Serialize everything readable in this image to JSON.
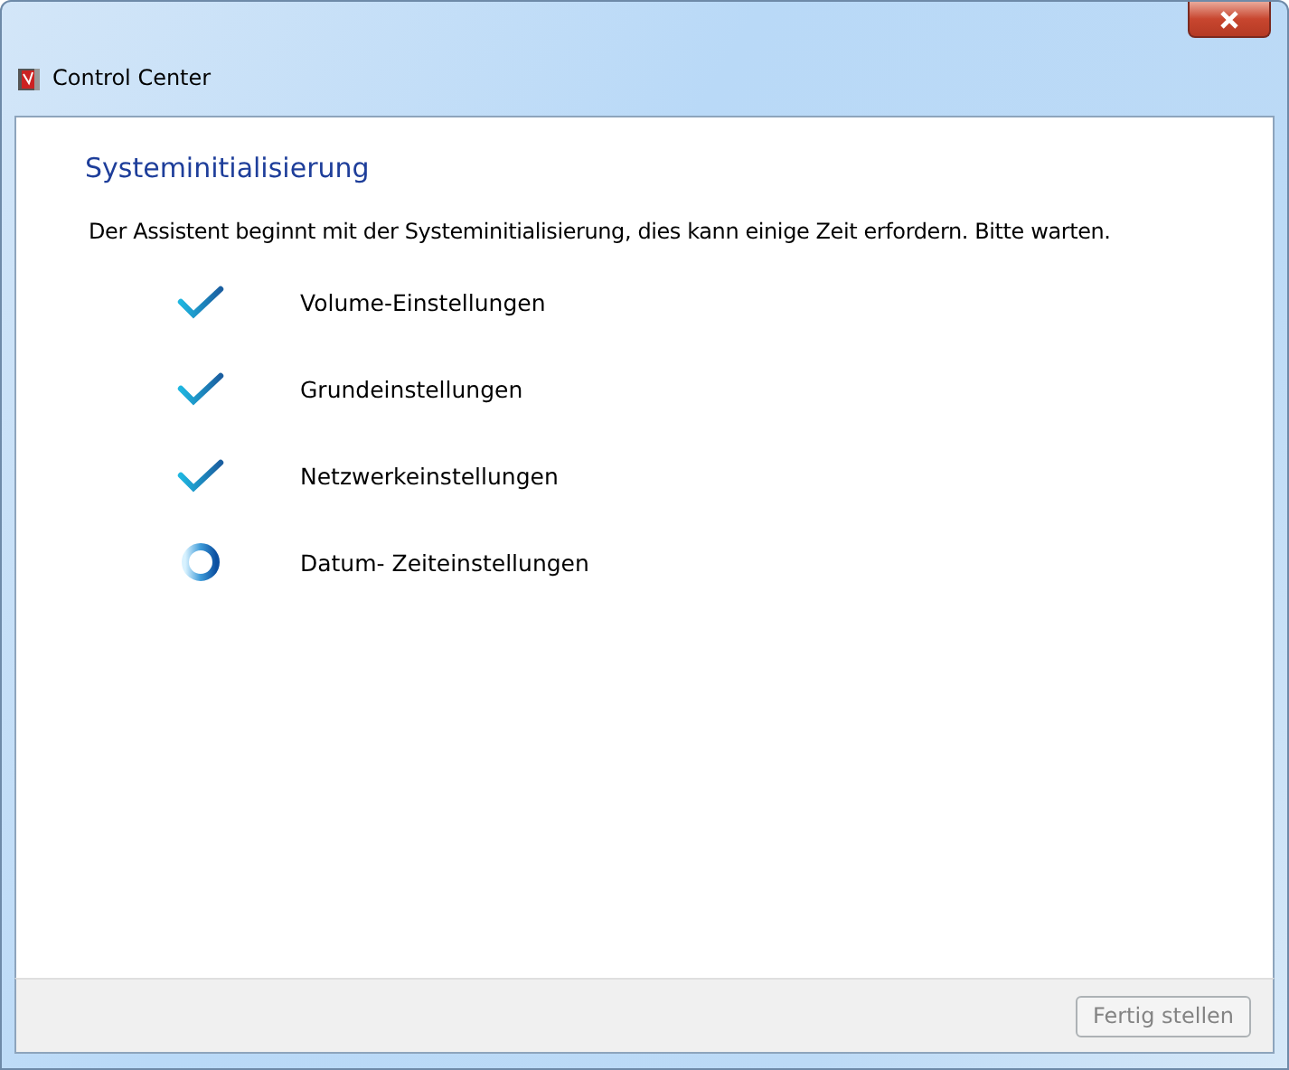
{
  "window": {
    "title": "Control Center"
  },
  "heading": "Systeminitialisierung",
  "message": "Der Assistent beginnt mit der Systeminitialisierung, dies kann einige Zeit erfordern. Bitte warten.",
  "steps": [
    {
      "label": "Volume-Einstellungen",
      "kind": "done"
    },
    {
      "label": "Grundeinstellungen",
      "kind": "done"
    },
    {
      "label": "Netzwerkeinstellungen",
      "kind": "done"
    },
    {
      "label": "Datum-  Zeiteinstellungen",
      "kind": "running"
    }
  ],
  "finish_button": {
    "label": "Fertig stellen",
    "disabled": true
  }
}
